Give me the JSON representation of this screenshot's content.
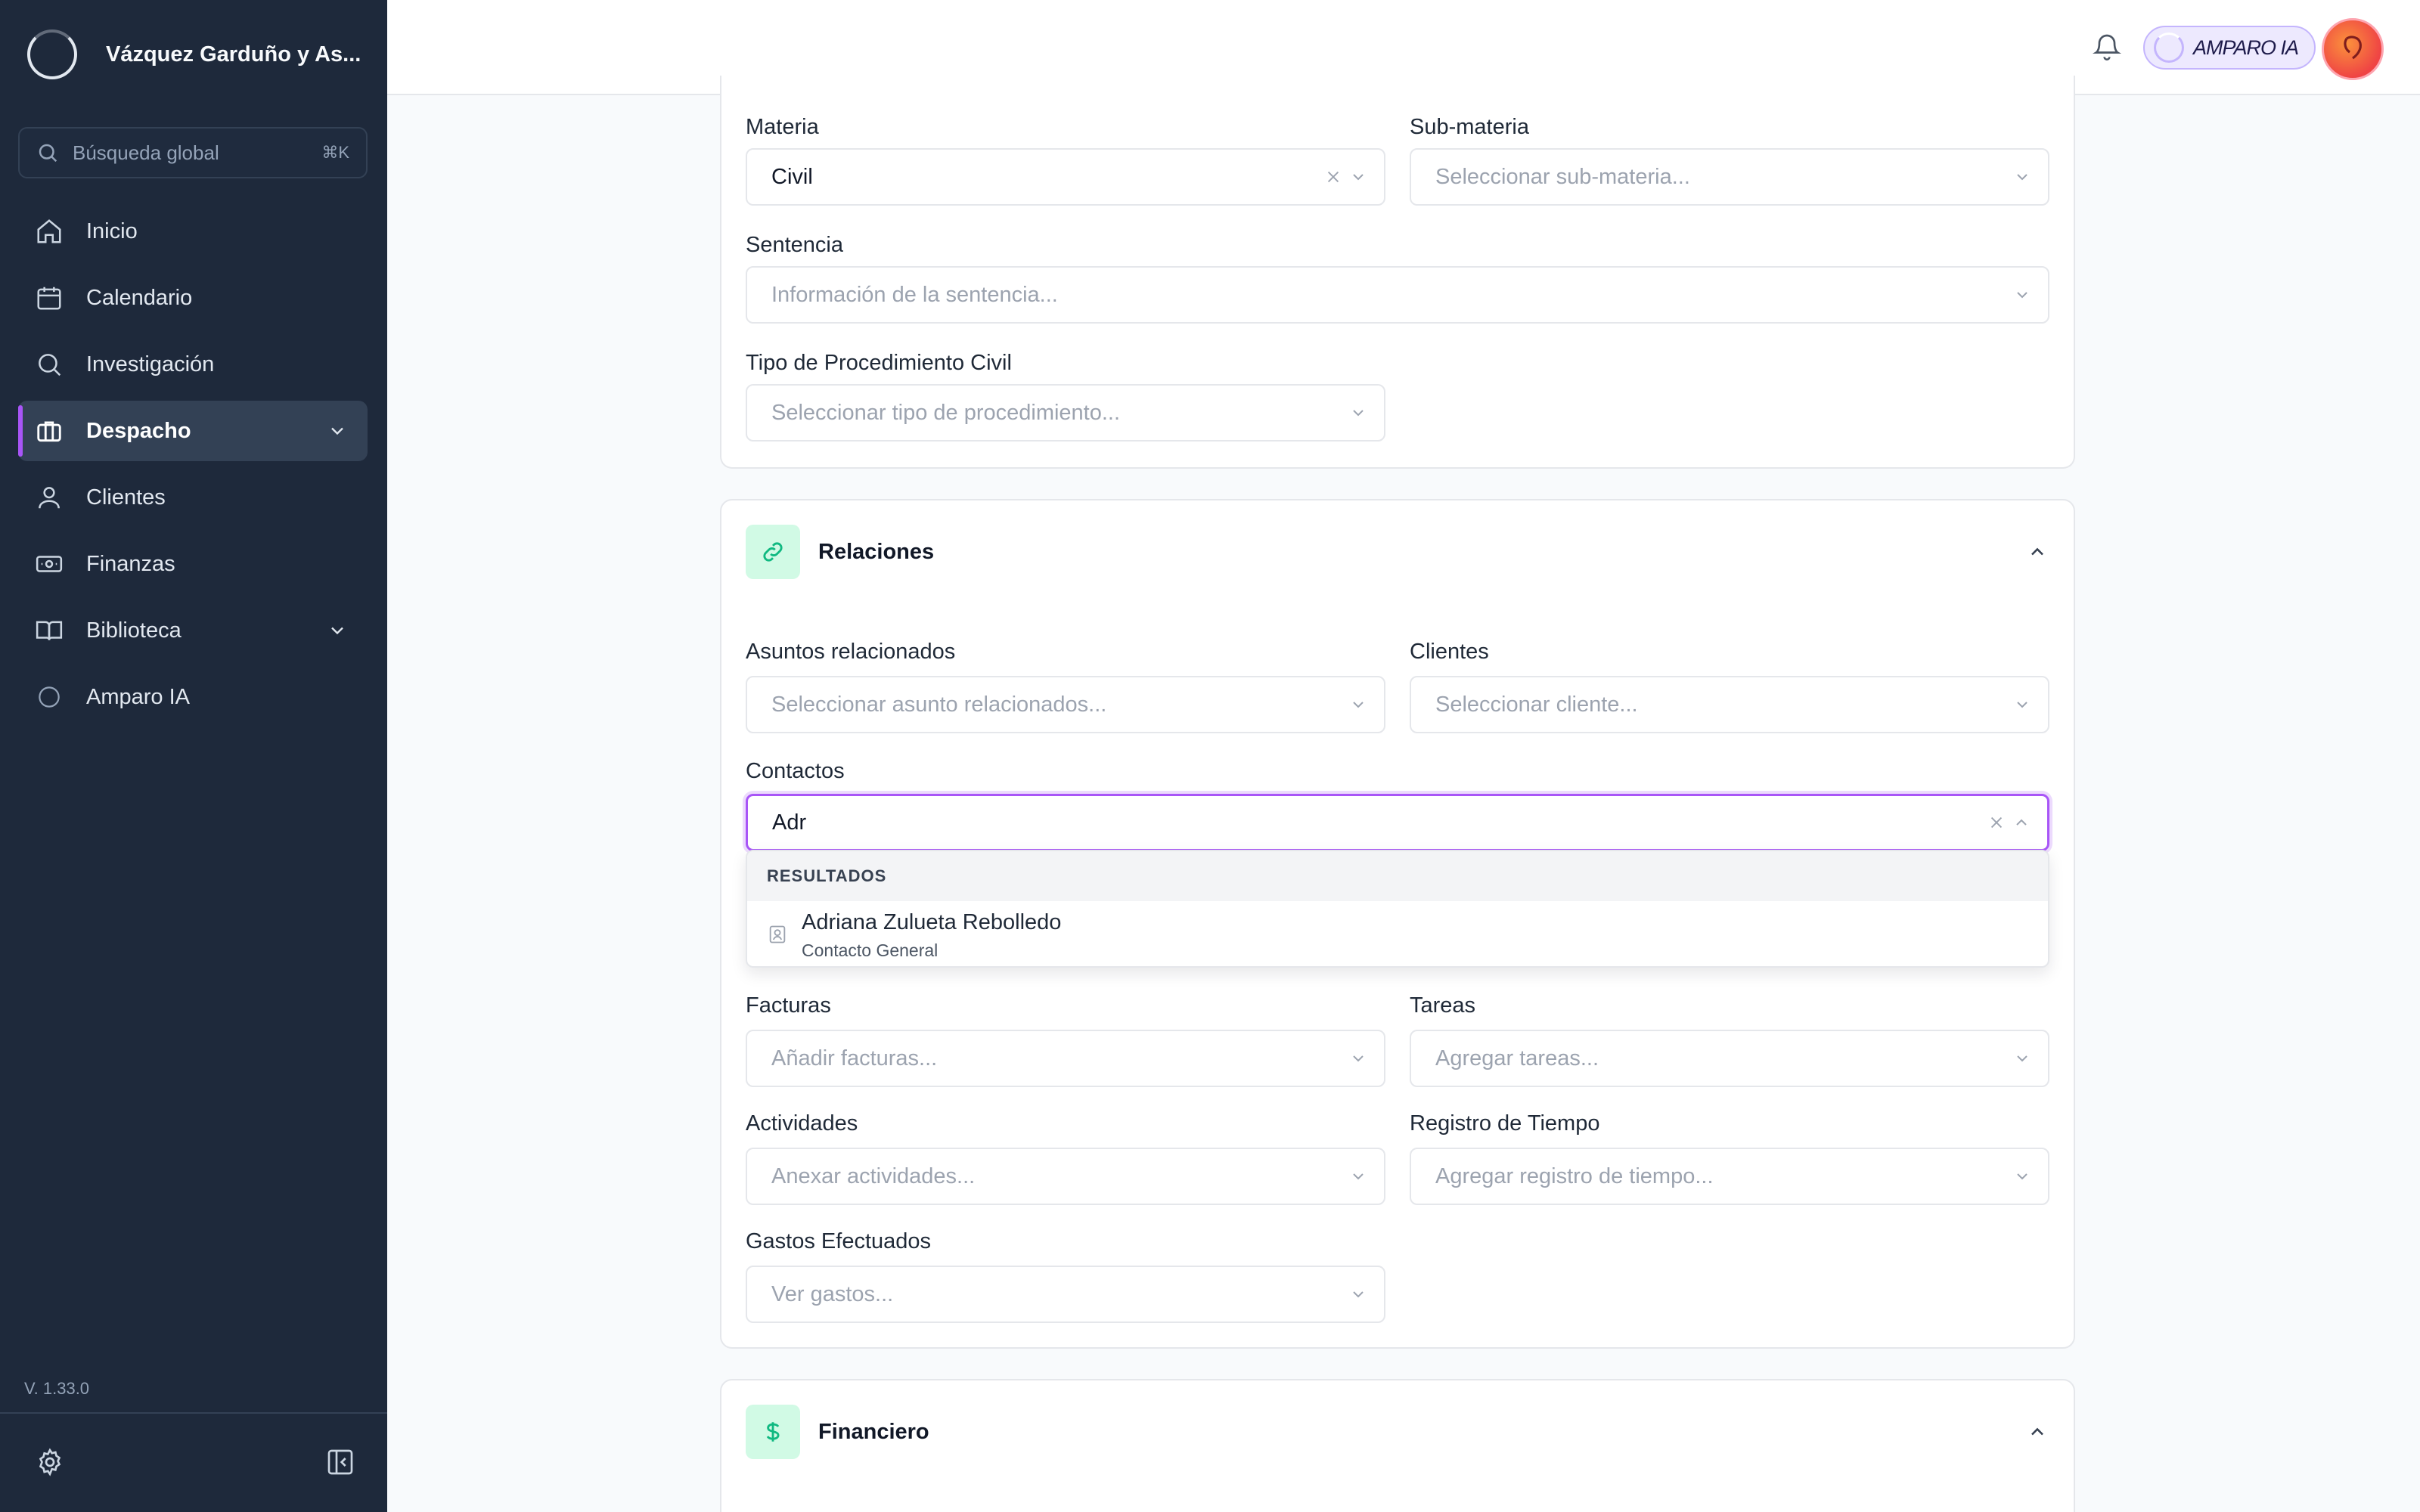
{
  "sidebar": {
    "brand_name": "Vázquez Garduño y As...",
    "search": {
      "placeholder": "Búsqueda global",
      "shortcut": "⌘K"
    },
    "items": [
      {
        "label": "Inicio",
        "icon": "home-icon"
      },
      {
        "label": "Calendario",
        "icon": "calendar-icon"
      },
      {
        "label": "Investigación",
        "icon": "search-icon"
      },
      {
        "label": "Despacho",
        "icon": "briefcase-icon",
        "active": true,
        "has_children": true
      },
      {
        "label": "Clientes",
        "icon": "user-icon"
      },
      {
        "label": "Finanzas",
        "icon": "money-icon"
      },
      {
        "label": "Biblioteca",
        "icon": "book-icon",
        "has_children": true
      },
      {
        "label": "Amparo IA",
        "icon": "circle-icon"
      }
    ],
    "version": "V. 1.33.0"
  },
  "header": {
    "ai_button_label": "AMPARO IA"
  },
  "case_details": {
    "materia": {
      "label": "Materia",
      "value": "Civil"
    },
    "sub_materia": {
      "label": "Sub-materia",
      "placeholder": "Seleccionar sub-materia..."
    },
    "sentencia": {
      "label": "Sentencia",
      "placeholder": "Información de la sentencia..."
    },
    "tipo_procedimiento": {
      "label": "Tipo de Procedimiento Civil",
      "placeholder": "Seleccionar tipo de procedimiento..."
    }
  },
  "relaciones": {
    "title": "Relaciones",
    "asuntos": {
      "label": "Asuntos relacionados",
      "placeholder": "Seleccionar asunto relacionados..."
    },
    "clientes": {
      "label": "Clientes",
      "placeholder": "Seleccionar cliente..."
    },
    "contactos": {
      "label": "Contactos",
      "value": "Adr",
      "dropdown": {
        "header": "RESULTADOS",
        "results": [
          {
            "name": "Adriana Zulueta Rebolledo",
            "type": "Contacto General"
          }
        ]
      }
    },
    "facturas": {
      "label": "Facturas",
      "placeholder": "Añadir facturas..."
    },
    "tareas": {
      "label": "Tareas",
      "placeholder": "Agregar tareas..."
    },
    "actividades": {
      "label": "Actividades",
      "placeholder": "Anexar actividades..."
    },
    "registro_tiempo": {
      "label": "Registro de Tiempo",
      "placeholder": "Agregar registro de tiempo..."
    },
    "gastos": {
      "label": "Gastos Efectuados",
      "placeholder": "Ver gastos..."
    }
  },
  "financiero": {
    "title": "Financiero"
  },
  "colors": {
    "sidebar_bg": "#1e293b",
    "accent_purple": "#a855f7",
    "section_icon_bg": "#d1fae5",
    "section_icon_fg": "#10b981"
  }
}
